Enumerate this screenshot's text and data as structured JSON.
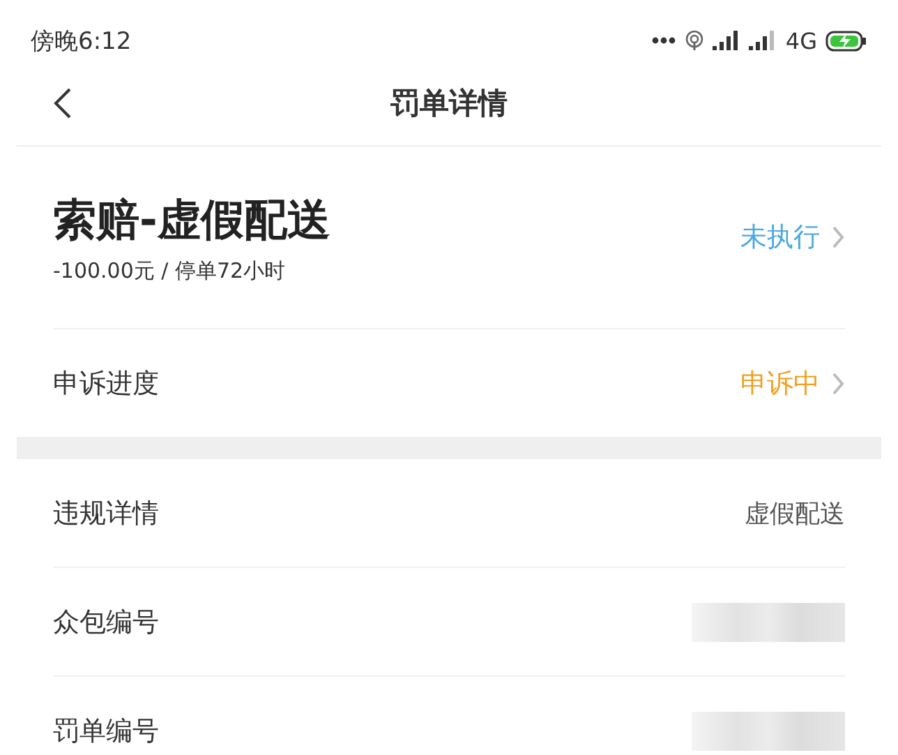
{
  "status_bar": {
    "time": "傍晚6:12",
    "network": "4G"
  },
  "nav": {
    "title": "罚单详情"
  },
  "penalty": {
    "title": "索赔-虚假配送",
    "subtitle": "-100.00元 / 停单72小时",
    "status": {
      "text": "未执行",
      "color": "#4aa8e0"
    }
  },
  "appeal": {
    "label": "申诉进度",
    "status": {
      "text": "申诉中",
      "color": "#f0a020"
    }
  },
  "details": [
    {
      "label": "违规详情",
      "kind": "text",
      "value": "虚假配送"
    },
    {
      "label": "众包编号",
      "kind": "redacted"
    },
    {
      "label": "罚单编号",
      "kind": "redacted"
    }
  ]
}
